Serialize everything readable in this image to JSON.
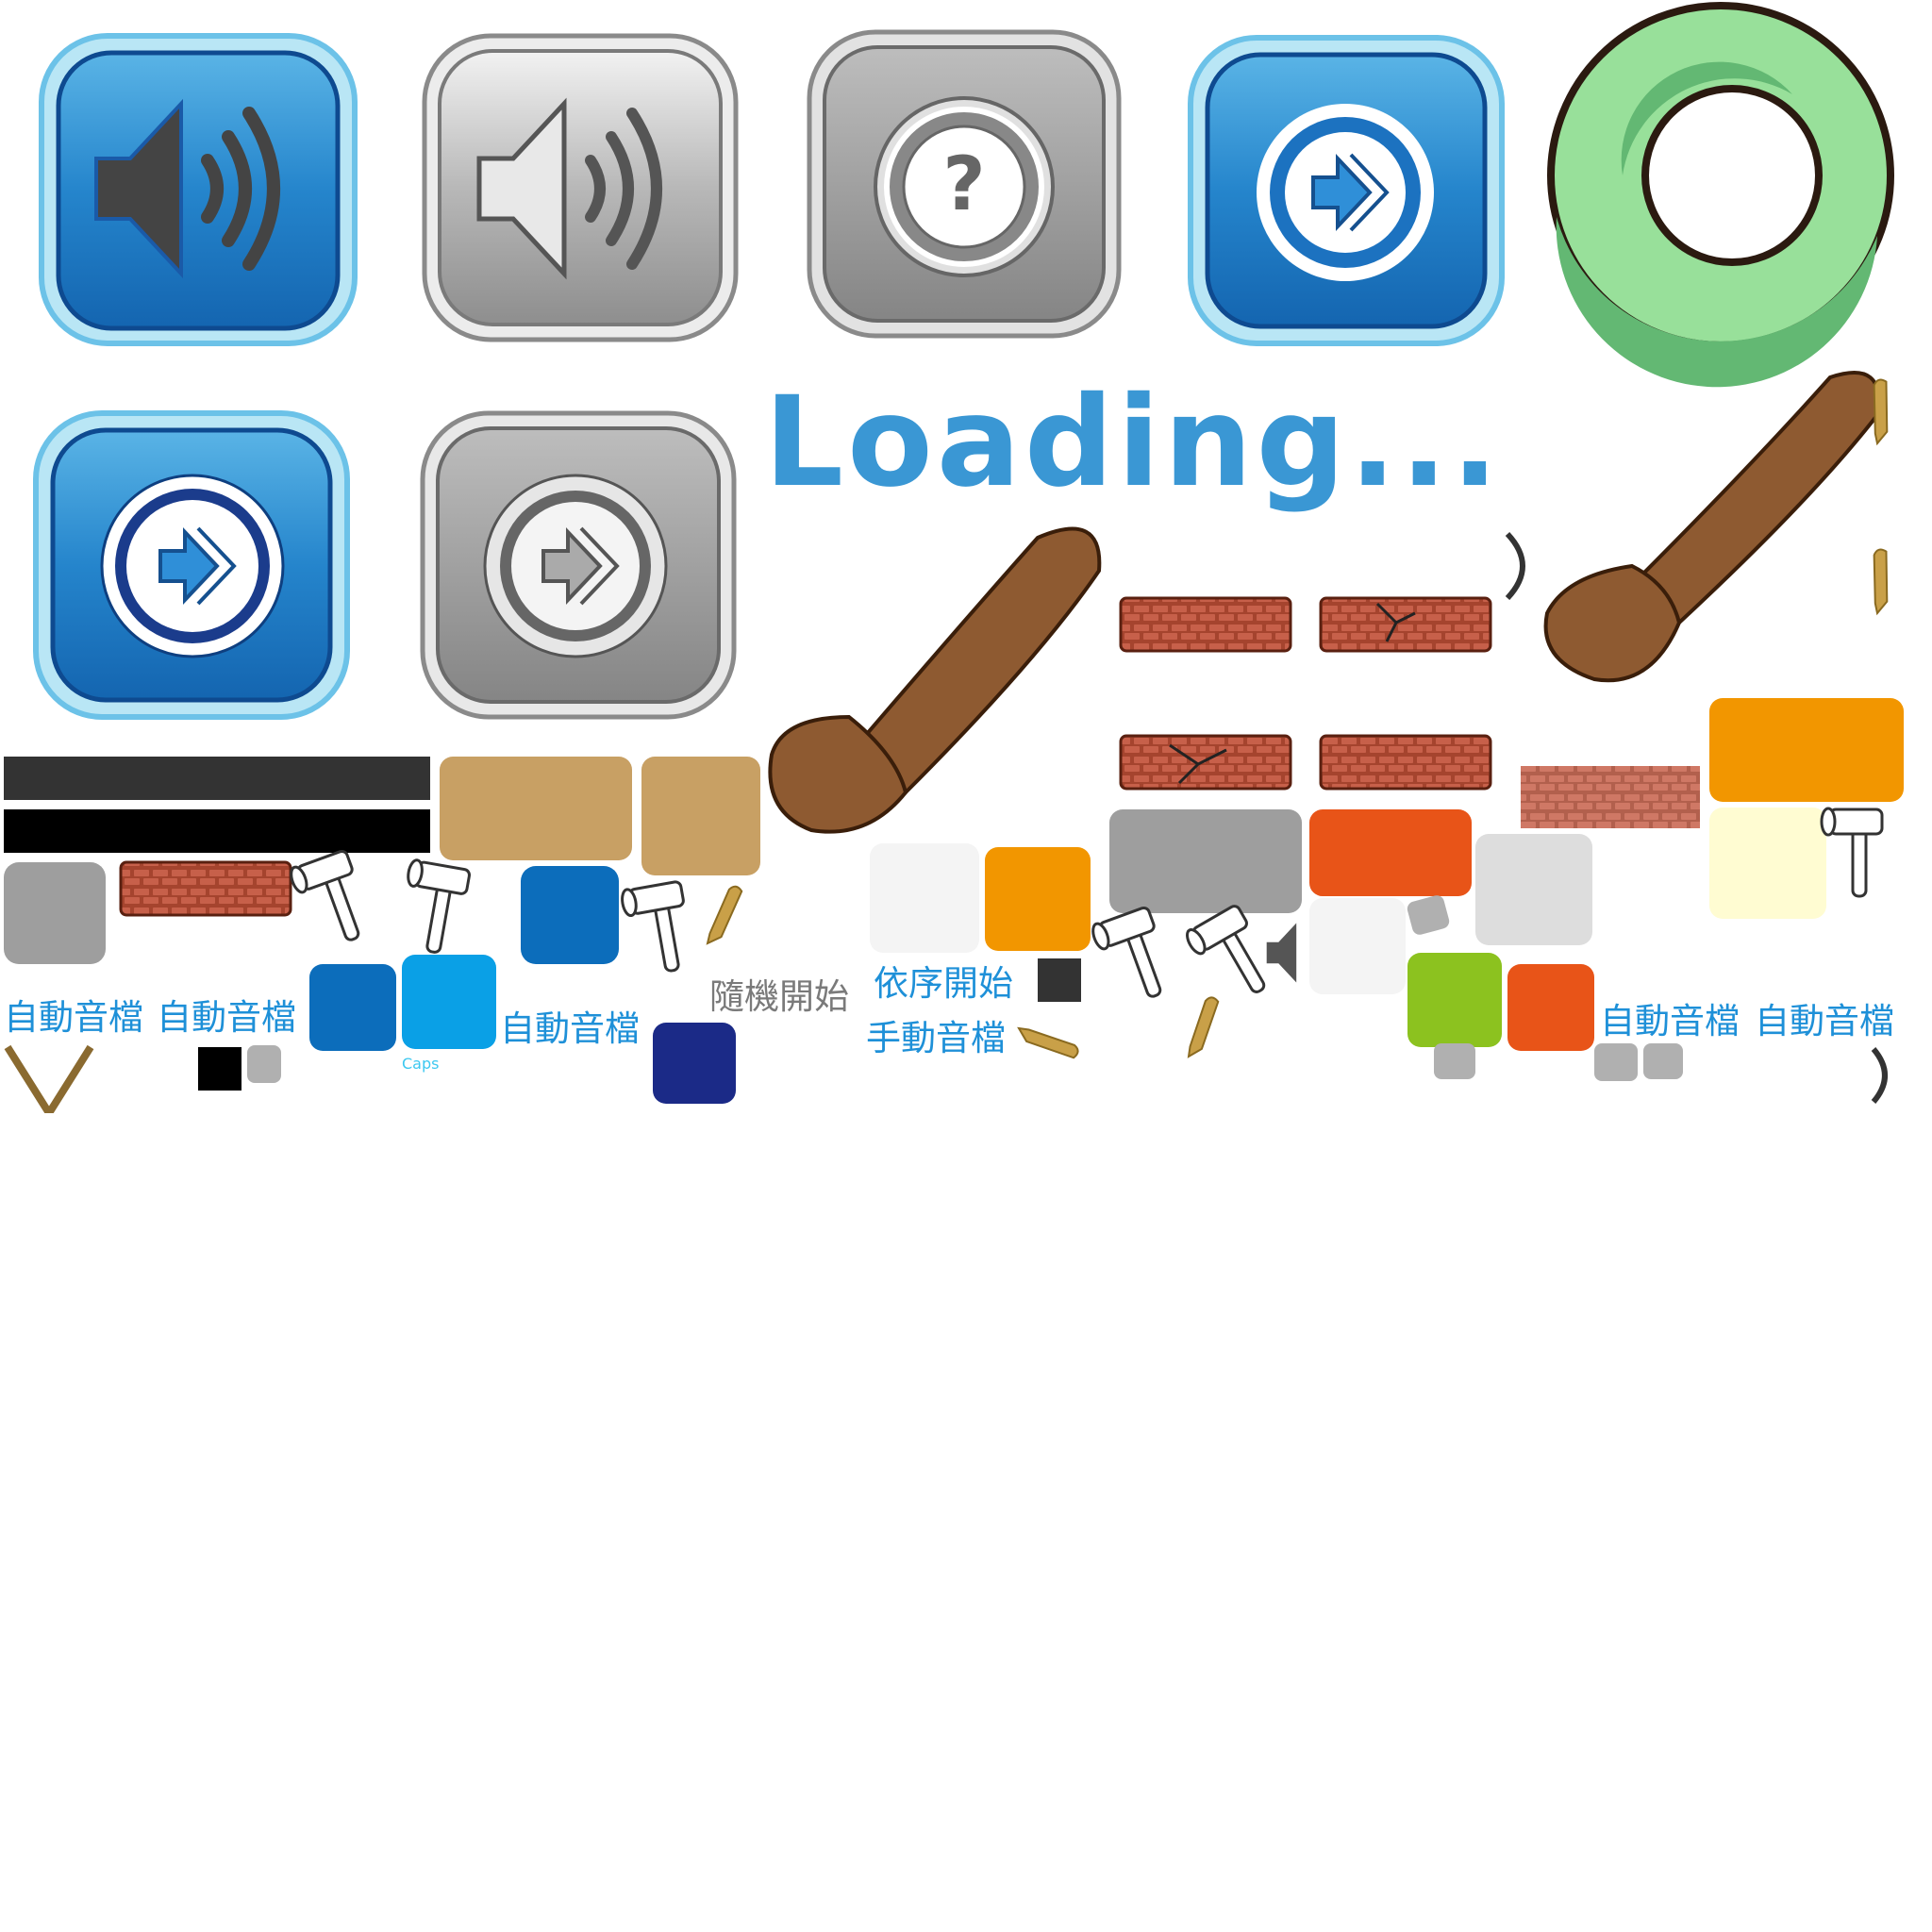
{
  "loading_text": "Loading...",
  "labels": {
    "auto_audio": "自動音檔",
    "random_start": "隨機開始",
    "sequential_start": "依序開始",
    "manual_audio": "手動音檔",
    "caps": "Caps"
  },
  "colors": {
    "blue_button": "#1c72c0",
    "blue_rim": "#8fd0ee",
    "gray_button": "#9a9a9a",
    "green_ring": "#98e09a",
    "brick": "#a5442e",
    "arm": "#8e5a31",
    "orange": "#f29600",
    "red_orange": "#e85418",
    "lime": "#8cc21f",
    "tan": "#c8a064",
    "navy": "#1b2a87",
    "label_blue": "#1e90d8"
  },
  "icons": [
    "speaker-icon",
    "question-icon",
    "forward-arrow-icon",
    "ring-icon",
    "fist-arm-icon",
    "hammer-icon",
    "brick-wall-icon",
    "bat-icon"
  ]
}
